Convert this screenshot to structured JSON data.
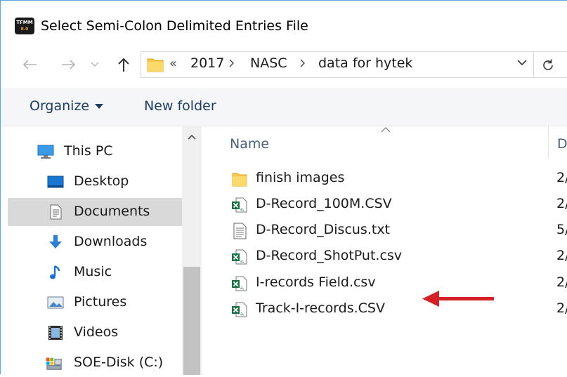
{
  "window": {
    "title": "Select Semi-Colon Delimited Entries File",
    "app_icon_text": "TFMM",
    "app_icon_sub": "8.0"
  },
  "address_bar": {
    "overflow": "«",
    "crumbs": [
      "2017",
      "NASC",
      "data for hytek"
    ]
  },
  "toolbar": {
    "organize_label": "Organize",
    "new_folder_label": "New folder"
  },
  "nav_pane": {
    "items": [
      {
        "label": "This PC",
        "icon": "computer-icon",
        "level": 0
      },
      {
        "label": "Desktop",
        "icon": "desktop-icon",
        "level": 1
      },
      {
        "label": "Documents",
        "icon": "documents-icon",
        "level": 1,
        "selected": true
      },
      {
        "label": "Downloads",
        "icon": "downloads-icon",
        "level": 1
      },
      {
        "label": "Music",
        "icon": "music-icon",
        "level": 1
      },
      {
        "label": "Pictures",
        "icon": "pictures-icon",
        "level": 1
      },
      {
        "label": "Videos",
        "icon": "videos-icon",
        "level": 1
      },
      {
        "label": "SOE-Disk (C:)",
        "icon": "disk-icon",
        "level": 1
      }
    ]
  },
  "file_list": {
    "columns": {
      "name": "Name",
      "date": "D"
    },
    "rows": [
      {
        "name": "finish images",
        "icon": "folder-icon",
        "date": "2/"
      },
      {
        "name": "D-Record_100M.CSV",
        "icon": "excel-csv-icon",
        "date": "2/"
      },
      {
        "name": "D-Record_Discus.txt",
        "icon": "text-file-icon",
        "date": "5/"
      },
      {
        "name": "D-Record_ShotPut.csv",
        "icon": "excel-csv-icon",
        "date": "2/"
      },
      {
        "name": "I-records Field.csv",
        "icon": "excel-csv-icon",
        "date": "2/"
      },
      {
        "name": "Track-I-records.CSV",
        "icon": "excel-csv-icon",
        "date": "2/"
      }
    ]
  },
  "colors": {
    "selection": "#d9d9d9",
    "toolbar_text": "#1f3c63",
    "annotation_arrow": "#d42027",
    "folder": "#f8c851",
    "excel_green": "#1e7145"
  }
}
